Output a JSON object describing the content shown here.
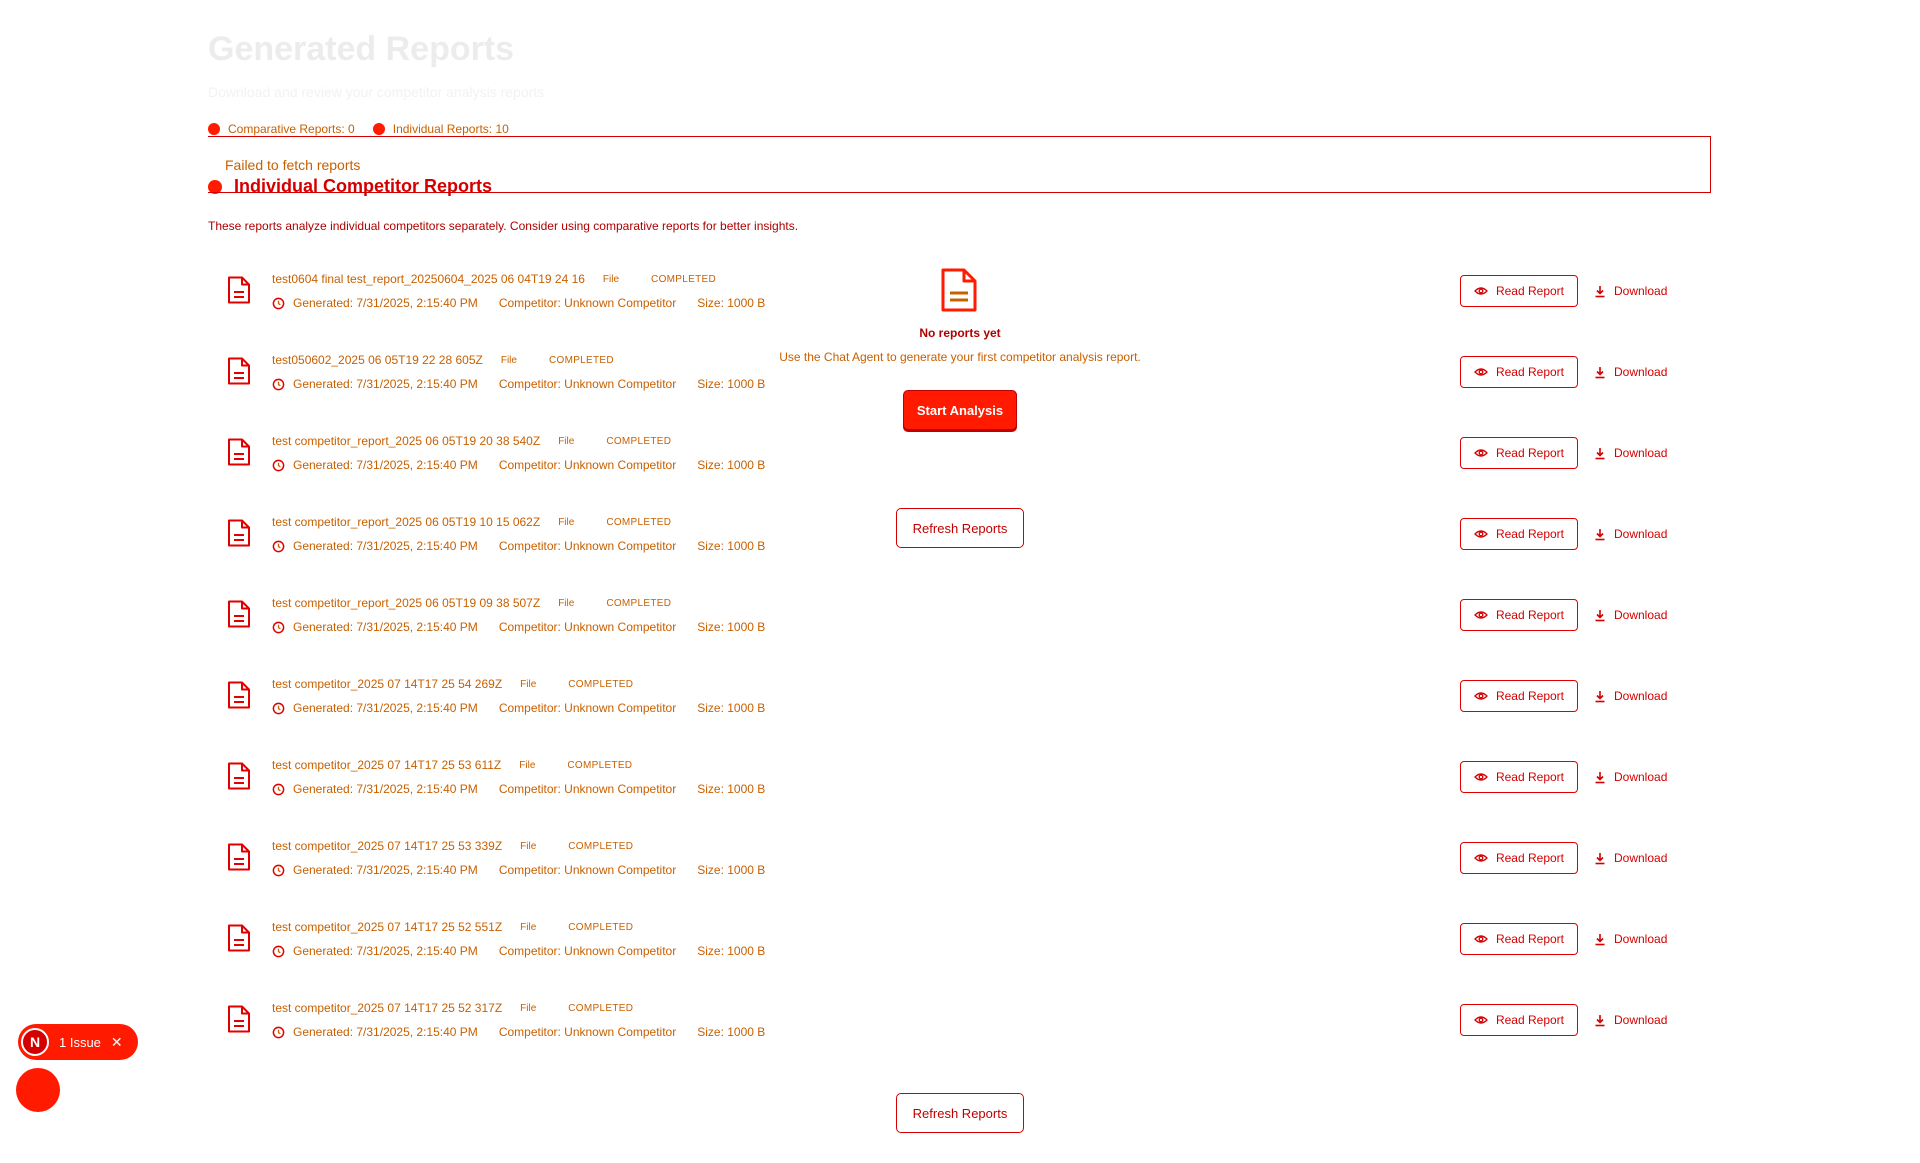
{
  "header": {
    "title": "Generated Reports",
    "subtitle": "Download and review your competitor analysis reports"
  },
  "counts": {
    "comparative": "Comparative Reports: 0",
    "individual": "Individual Reports: 10"
  },
  "error": {
    "message": "Failed to fetch reports"
  },
  "section": {
    "title": "Individual Competitor Reports",
    "description": "These reports analyze individual competitors separately. Consider using comparative reports for better insights."
  },
  "reports": [
    {
      "name": "test0604 final test_report_20250604_2025 06 04T19 24 16",
      "type": "File",
      "status": "COMPLETED",
      "generated": "Generated: 7/31/2025, 2:15:40 PM",
      "competitor": "Competitor: Unknown Competitor",
      "size": "Size: 1000 B"
    },
    {
      "name": "test050602_2025 06 05T19 22 28 605Z",
      "type": "File",
      "status": "COMPLETED",
      "generated": "Generated: 7/31/2025, 2:15:40 PM",
      "competitor": "Competitor: Unknown Competitor",
      "size": "Size: 1000 B"
    },
    {
      "name": "test competitor_report_2025 06 05T19 20 38 540Z",
      "type": "File",
      "status": "COMPLETED",
      "generated": "Generated: 7/31/2025, 2:15:40 PM",
      "competitor": "Competitor: Unknown Competitor",
      "size": "Size: 1000 B"
    },
    {
      "name": "test competitor_report_2025 06 05T19 10 15 062Z",
      "type": "File",
      "status": "COMPLETED",
      "generated": "Generated: 7/31/2025, 2:15:40 PM",
      "competitor": "Competitor: Unknown Competitor",
      "size": "Size: 1000 B"
    },
    {
      "name": "test competitor_report_2025 06 05T19 09 38 507Z",
      "type": "File",
      "status": "COMPLETED",
      "generated": "Generated: 7/31/2025, 2:15:40 PM",
      "competitor": "Competitor: Unknown Competitor",
      "size": "Size: 1000 B"
    },
    {
      "name": "test competitor_2025 07 14T17 25 54 269Z",
      "type": "File",
      "status": "COMPLETED",
      "generated": "Generated: 7/31/2025, 2:15:40 PM",
      "competitor": "Competitor: Unknown Competitor",
      "size": "Size: 1000 B"
    },
    {
      "name": "test competitor_2025 07 14T17 25 53 611Z",
      "type": "File",
      "status": "COMPLETED",
      "generated": "Generated: 7/31/2025, 2:15:40 PM",
      "competitor": "Competitor: Unknown Competitor",
      "size": "Size: 1000 B"
    },
    {
      "name": "test competitor_2025 07 14T17 25 53 339Z",
      "type": "File",
      "status": "COMPLETED",
      "generated": "Generated: 7/31/2025, 2:15:40 PM",
      "competitor": "Competitor: Unknown Competitor",
      "size": "Size: 1000 B"
    },
    {
      "name": "test competitor_2025 07 14T17 25 52 551Z",
      "type": "File",
      "status": "COMPLETED",
      "generated": "Generated: 7/31/2025, 2:15:40 PM",
      "competitor": "Competitor: Unknown Competitor",
      "size": "Size: 1000 B"
    },
    {
      "name": "test competitor_2025 07 14T17 25 52 317Z",
      "type": "File",
      "status": "COMPLETED",
      "generated": "Generated: 7/31/2025, 2:15:40 PM",
      "competitor": "Competitor: Unknown Competitor",
      "size": "Size: 1000 B"
    }
  ],
  "actions": {
    "read_label": "Read Report",
    "download_label": "Download"
  },
  "empty_state": {
    "icon": "document-icon",
    "title": "No reports yet",
    "description": "Use the Chat Agent to generate your first competitor analysis report.",
    "start_label": "Start Analysis",
    "refresh_label": "Refresh Reports"
  },
  "footer": {
    "refresh_label": "Refresh Reports"
  },
  "dev_overlay": {
    "badge_letter": "N",
    "issue_label": "1 Issue",
    "close_glyph": "✕"
  },
  "colors": {
    "accent": "#ff1a00",
    "text_red": "#d40000",
    "text_orange": "#c86000"
  }
}
